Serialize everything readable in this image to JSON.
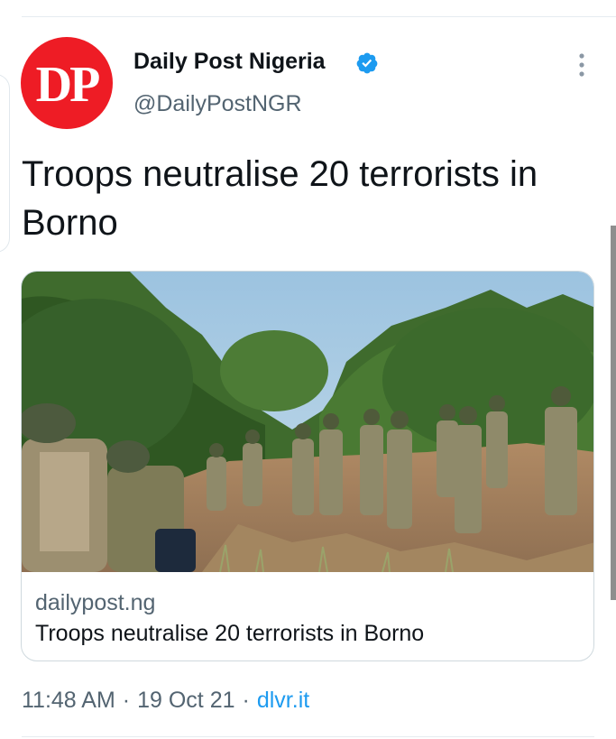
{
  "author": {
    "avatar_text": "DP",
    "display_name": "Daily Post Nigeria",
    "handle": "@DailyPostNGR",
    "verified_icon": "verified-badge-icon",
    "menu_icon": "more-vertical-icon"
  },
  "tweet": {
    "text": "Troops neutralise 20 terrorists in Borno"
  },
  "card": {
    "domain": "dailypost.ng",
    "title": "Troops neutralise 20 terrorists in Borno"
  },
  "meta": {
    "time": "11:48 AM",
    "date": "19 Oct 21",
    "source": "dlvr.it",
    "separator": "·"
  },
  "colors": {
    "brand_red": "#ee1c25",
    "verified_blue": "#1d9bf0",
    "link_blue": "#1d9bf0",
    "secondary_text": "#536471",
    "primary_text": "#0f1419",
    "border": "#cfd9de"
  }
}
